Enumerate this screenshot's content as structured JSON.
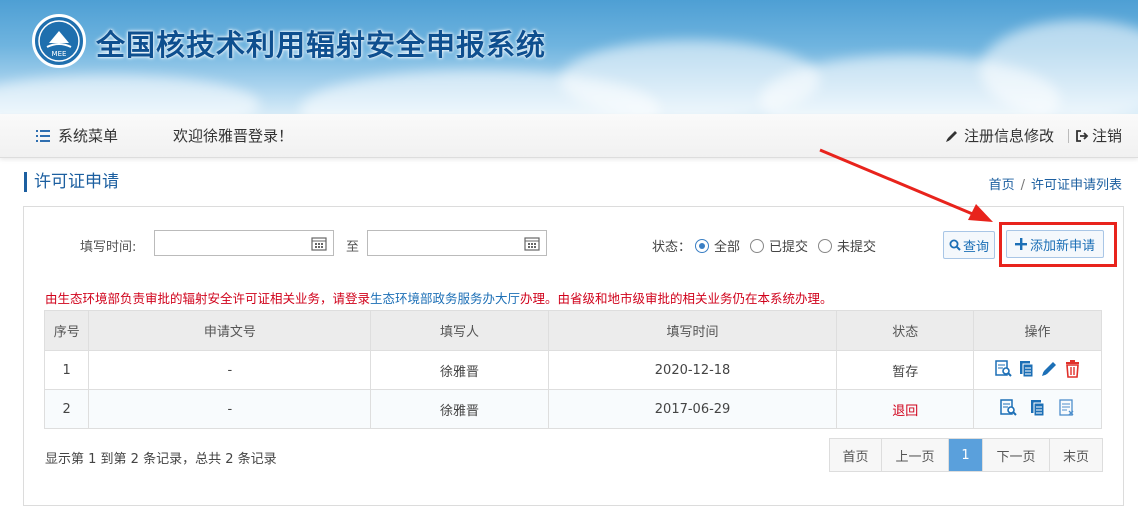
{
  "banner": {
    "title": "全国核技术利用辐射安全申报系统",
    "logo_text": "MEE",
    "logo_icon": "mee-logo"
  },
  "menubar": {
    "menu_label": "系统菜单",
    "welcome": "欢迎徐雅晋登录！",
    "edit_profile": "注册信息修改",
    "logout": "注销"
  },
  "page": {
    "title": "许可证申请",
    "breadcrumb": {
      "home": "首页",
      "sep": "/",
      "current": "许可证申请列表"
    }
  },
  "filters": {
    "date_label": "填写时间:",
    "date_from": "",
    "date_to": "",
    "to_label": "至",
    "status_label": "状态：",
    "status_options": [
      "全部",
      "已提交",
      "未提交"
    ],
    "status_selected": "全部",
    "query_button": "查询",
    "add_button": "添加新申请"
  },
  "notice": {
    "part1": "由生态环境部负责审批的辐射安全许可证相关业务，请登录",
    "link": "生态环境部政务服务办大厅",
    "part2": "办理。由省级和地市级审批的相关业务仍在本系统办理。"
  },
  "table": {
    "headers": [
      "序号",
      "申请文号",
      "填写人",
      "填写时间",
      "状态",
      "操作"
    ],
    "rows": [
      {
        "no": "1",
        "doc_no": "-",
        "filler": "徐雅晋",
        "date": "2020-12-18",
        "status": "暂存",
        "status_color": "#444444",
        "actions": [
          "view-icon",
          "copy-icon",
          "edit-icon",
          "delete-icon"
        ]
      },
      {
        "no": "2",
        "doc_no": "-",
        "filler": "徐雅晋",
        "date": "2017-06-29",
        "status": "退回",
        "status_color": "#d0021b",
        "actions": [
          "view-icon",
          "copy-icon",
          "detail-icon"
        ]
      }
    ]
  },
  "footer": {
    "record_info": "显示第 1 到第 2 条记录，总共 2 条记录",
    "pager": {
      "first": "首页",
      "prev": "上一页",
      "current": "1",
      "next": "下一页",
      "last": "末页"
    }
  },
  "colors": {
    "primary": "#1c5fa0",
    "annotation": "#e8231c",
    "notice": "#d0021b"
  }
}
